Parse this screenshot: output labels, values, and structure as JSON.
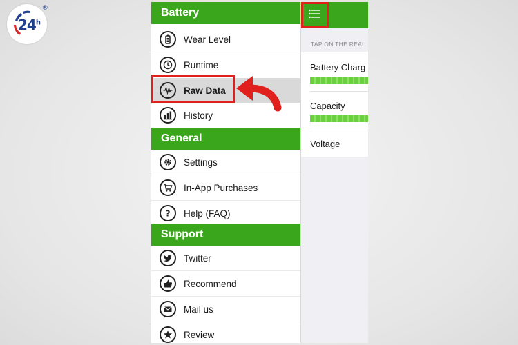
{
  "logo": {
    "text": "24",
    "sup": "h",
    "reg": "®"
  },
  "menu": {
    "sections": [
      {
        "title": "Battery",
        "items": [
          {
            "label": "Wear Level",
            "icon": "battery-icon"
          },
          {
            "label": "Runtime",
            "icon": "clock-icon"
          },
          {
            "label": "Raw Data",
            "icon": "waveform-icon",
            "active": true
          },
          {
            "label": "History",
            "icon": "bar-chart-icon"
          }
        ]
      },
      {
        "title": "General",
        "items": [
          {
            "label": "Settings",
            "icon": "gear-icon"
          },
          {
            "label": "In-App Purchases",
            "icon": "cart-icon"
          },
          {
            "label": "Help (FAQ)",
            "icon": "question-icon"
          }
        ]
      },
      {
        "title": "Support",
        "items": [
          {
            "label": "Twitter",
            "icon": "twitter-icon"
          },
          {
            "label": "Recommend",
            "icon": "thumbs-up-icon"
          },
          {
            "label": "Mail us",
            "icon": "mail-icon"
          },
          {
            "label": "Review",
            "icon": "star-icon"
          }
        ]
      }
    ]
  },
  "content": {
    "hint": "TAP ON THE REAL",
    "rows": [
      {
        "label": "Battery Charg",
        "has_bar": true
      },
      {
        "label": "Capacity",
        "has_bar": true
      },
      {
        "label": "Voltage",
        "has_bar": false
      }
    ]
  },
  "colors": {
    "accent": "#3aa61c",
    "highlight": "#e0201c",
    "bar": "#6bd03e"
  }
}
